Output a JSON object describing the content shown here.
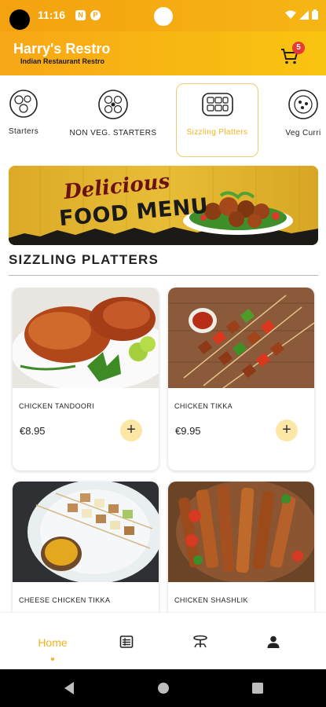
{
  "status_bar": {
    "time": "11:16",
    "notif_icons": [
      "N",
      "P"
    ],
    "system_icons": [
      "wifi-icon",
      "signal-icon",
      "battery-icon"
    ]
  },
  "header": {
    "title": "Harry's Restro",
    "subtitle": "Indian Restaurant Restro",
    "cart_count": "5",
    "cart_icon": "cart-icon"
  },
  "categories": [
    {
      "label": "Starters",
      "icon": "starters-plate-icon",
      "active": false
    },
    {
      "label": "NON VEG. STARTERS",
      "icon": "non-veg-plate-icon",
      "active": false
    },
    {
      "label": "Sizzling Platters",
      "icon": "sizzling-platter-icon",
      "active": true
    },
    {
      "label": "Veg Curri",
      "icon": "veg-curry-plate-icon",
      "active": false
    }
  ],
  "banner": {
    "line1": "Delicious",
    "line2": "FOOD MENU"
  },
  "section": {
    "title": "SIZZLING PLATTERS"
  },
  "products": [
    {
      "name": "CHICKEN TANDOORI",
      "price": "€8.95"
    },
    {
      "name": "CHICKEN TIKKA",
      "price": "€9.95"
    },
    {
      "name": "CHEESE CHICKEN TIKKA",
      "price": ""
    },
    {
      "name": "CHICKEN SHASHLIK",
      "price": ""
    }
  ],
  "add_label": "+",
  "bottom_nav": {
    "home_label": "Home",
    "items": [
      "home",
      "menu-icon",
      "dining-table-icon",
      "profile-icon"
    ]
  },
  "colors": {
    "accent": "#f6b21c",
    "header_start": "#f7a716",
    "header_end": "#f9c410",
    "badge": "#e53935",
    "add_button": "#fde7a7"
  }
}
